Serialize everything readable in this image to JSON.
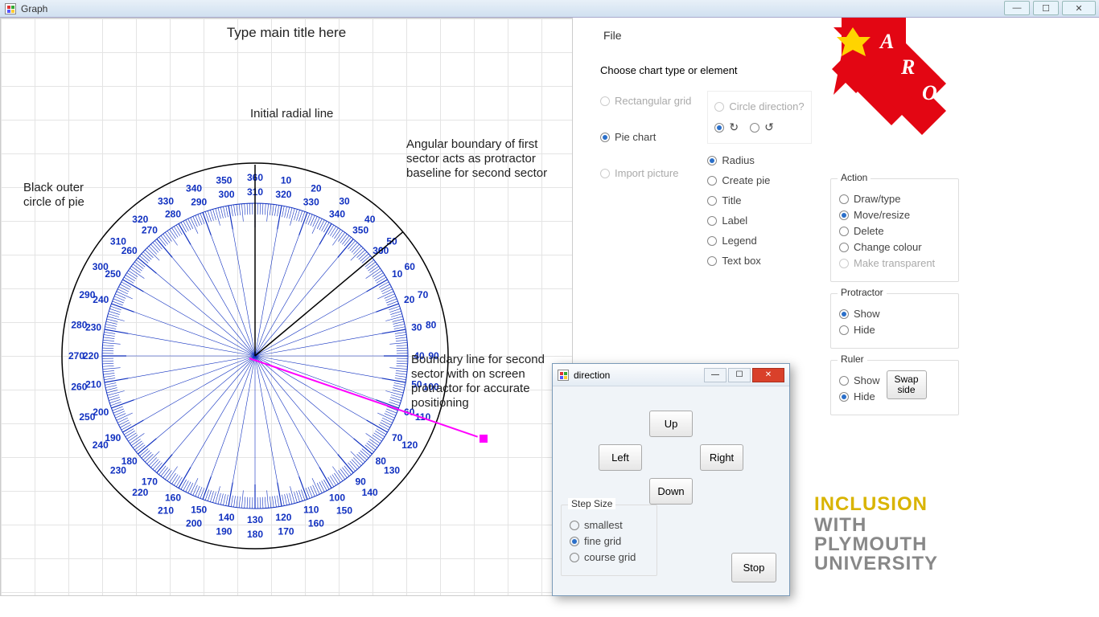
{
  "window": {
    "title": "Graph"
  },
  "chart": {
    "title": "Type main title here",
    "annotations": {
      "initial": "Initial radial line",
      "outer": "Black outer\ncircle of pie",
      "boundary1": "Angular boundary of first\nsector acts as protractor\nbaseline for second sector",
      "boundary2": "Boundary line for second\nsector with on screen\nprotractor for accurate\npositioning"
    }
  },
  "menu": {
    "file": "File"
  },
  "choose": {
    "legend": "Choose chart type or element",
    "rect": "Rectangular grid",
    "pie": "Pie chart",
    "import": "Import picture",
    "circdir": "Circle direction?",
    "radius": "Radius",
    "createpie": "Create pie",
    "title": "Title",
    "label": "Label",
    "legendopt": "Legend",
    "textbox": "Text box"
  },
  "action": {
    "legend": "Action",
    "draw": "Draw/type",
    "move": "Move/resize",
    "delete": "Delete",
    "colour": "Change colour",
    "trans": "Make transparent"
  },
  "protractor": {
    "legend": "Protractor",
    "show": "Show",
    "hide": "Hide"
  },
  "ruler": {
    "legend": "Ruler",
    "show": "Show",
    "hide": "Hide",
    "swap": "Swap side"
  },
  "dlg": {
    "title": "direction",
    "up": "Up",
    "down": "Down",
    "left": "Left",
    "right": "Right",
    "stop": "Stop",
    "step_legend": "Step Size",
    "smallest": "smallest",
    "fine": "fine grid",
    "course": "course grid"
  },
  "plymouth": {
    "l1": "INCLUSION",
    "l2": "WITH",
    "l3": "PLYMOUTH",
    "l4": "UNIVERSITY"
  },
  "aro": "ARO"
}
